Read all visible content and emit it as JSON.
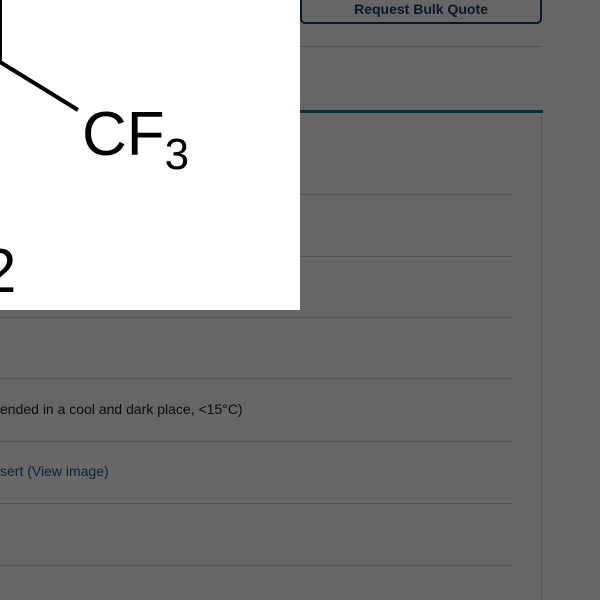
{
  "header": {
    "bulk_quote_label": "Request Bulk Quote"
  },
  "specs": {
    "storage_text": "ended in a cool and dark place, <15°C)",
    "insert_link": "sert (View image)"
  },
  "structure_image": {
    "group_label": "CF",
    "group_subscript": "3",
    "partial_label": "2"
  }
}
